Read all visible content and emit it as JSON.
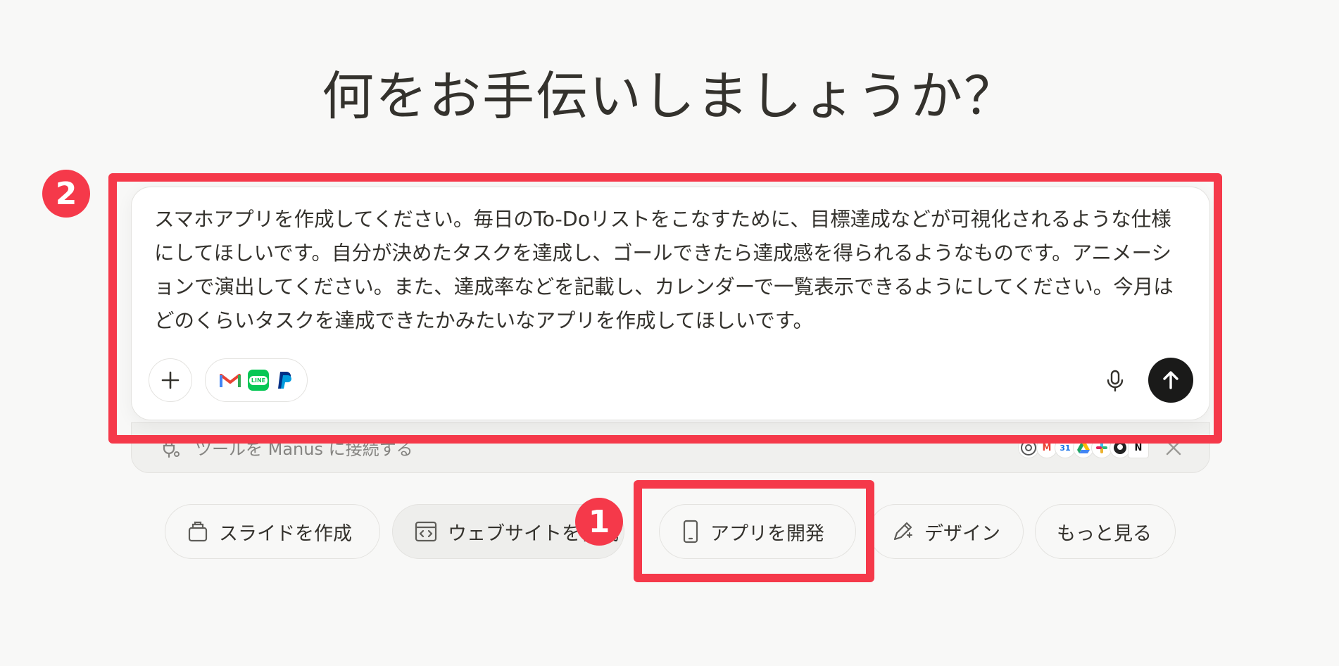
{
  "heading": "何をお手伝いしましょうか？",
  "composer": {
    "prompt": "スマホアプリを作成してください。毎日のTo-Doリストをこなすために、目標達成などが可視化されるような仕様にしてほしいです。自分が決めたタスクを達成し、ゴールできたら達成感を得られるようなものです。アニメーションで演出してください。また、達成率などを記載し、カレンダーで一覧表示できるようにしてください。今月はどのくらいタスクを達成できたかみたいなアプリを作成してほしいです。",
    "plus_icon": "plus-icon",
    "connected_apps": [
      "gmail-icon",
      "line-icon",
      "paypal-icon"
    ],
    "mic_icon": "microphone-icon",
    "send_icon": "arrow-up-icon"
  },
  "connect_bar": {
    "text": "ツールを Manus に接続する",
    "tools": [
      "chrome-icon",
      "gmail-icon",
      "google-calendar-icon",
      "google-drive-icon",
      "slack-icon",
      "github-icon",
      "notion-icon"
    ],
    "calendar_day": "31",
    "notion_letter": "N",
    "close_icon": "close-icon"
  },
  "chips": [
    {
      "label": "スライドを作成",
      "icon": "presentation-icon"
    },
    {
      "label": "ウェブサイトを作成",
      "icon": "website-code-icon"
    },
    {
      "label": "アプリを開発",
      "icon": "mobile-phone-icon"
    },
    {
      "label": "デザイン",
      "icon": "design-pen-icon"
    },
    {
      "label": "もっと見る",
      "icon": ""
    }
  ],
  "annotations": {
    "badge_1": "1",
    "badge_2": "2",
    "highlight_color": "#f5394a"
  },
  "line_label": "LINE"
}
